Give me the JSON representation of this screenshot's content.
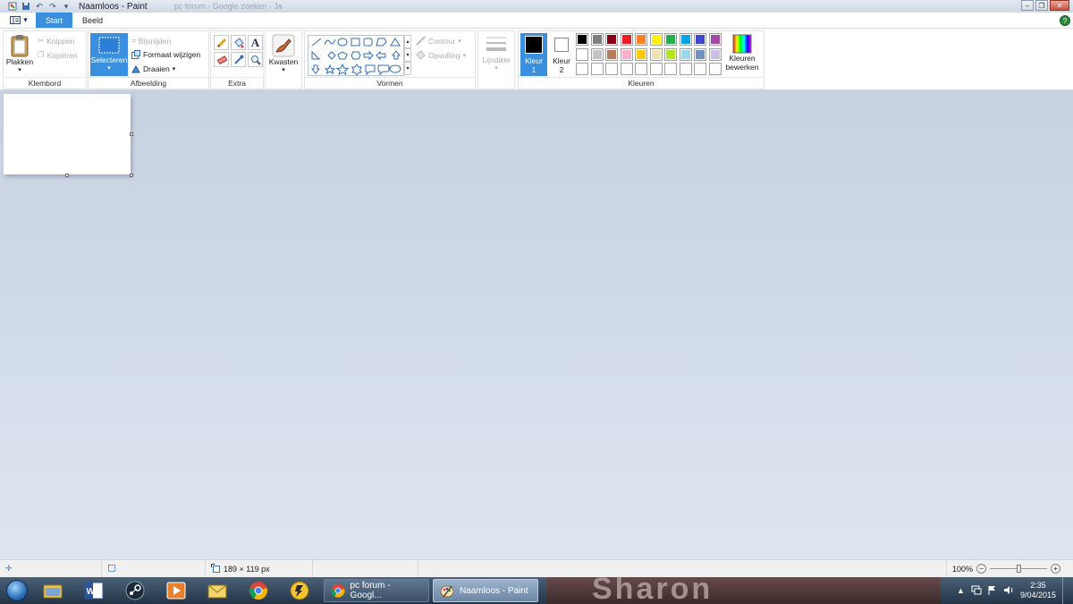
{
  "window": {
    "title": "Naamloos - Paint",
    "background_tab_hint": "pc forum - Google zoeken - Ja"
  },
  "tabs": [
    {
      "label": "Start",
      "active": true
    },
    {
      "label": "Beeld",
      "active": false
    }
  ],
  "ribbon": {
    "klembord": {
      "label": "Klembord",
      "paste": "Plakken",
      "cut": "Knippen",
      "copy": "Kopiëren"
    },
    "afbeelding": {
      "label": "Afbeelding",
      "select": "Selecteren",
      "crop": "Bijsnijden",
      "resize": "Formaat wijzigen",
      "rotate": "Draaien"
    },
    "extra": {
      "label": "Extra"
    },
    "kwasten": {
      "label": "Kwasten"
    },
    "vormen": {
      "label": "Vormen",
      "outline": "Contour",
      "fill": "Opvulling"
    },
    "lijndikte": {
      "label": "Lijndikte"
    },
    "kleuren": {
      "label": "Kleuren",
      "color1_line1": "Kleur",
      "color1_line2": "1",
      "color2_line1": "Kleur",
      "color2_line2": "2",
      "edit_line1": "Kleuren",
      "edit_line2": "bewerken",
      "color1": "#000000",
      "color2": "#ffffff",
      "palette_row1": [
        "#000000",
        "#7f7f7f",
        "#880015",
        "#ed1c24",
        "#ff7f27",
        "#fff200",
        "#22b14c",
        "#00a2e8",
        "#3f48cc",
        "#a349a4"
      ],
      "palette_row2": [
        "#ffffff",
        "#c3c3c3",
        "#b97a57",
        "#ffaec9",
        "#ffc90e",
        "#efe4b0",
        "#b5e61d",
        "#99d9ea",
        "#7092be",
        "#c8bfe7"
      ],
      "palette_row3": [
        "#ffffff",
        "#ffffff",
        "#ffffff",
        "#ffffff",
        "#ffffff",
        "#ffffff",
        "#ffffff",
        "#ffffff",
        "#ffffff",
        "#ffffff"
      ]
    }
  },
  "status": {
    "image_size": "189 × 119 px",
    "zoom": "100%"
  },
  "taskbar": {
    "tasks": [
      {
        "label": "pc forum - Googl...",
        "active": false
      },
      {
        "label": "Naamloos - Paint",
        "active": true
      }
    ],
    "background_text": "Sharon",
    "time": "2:35",
    "date": "9/04/2015"
  }
}
